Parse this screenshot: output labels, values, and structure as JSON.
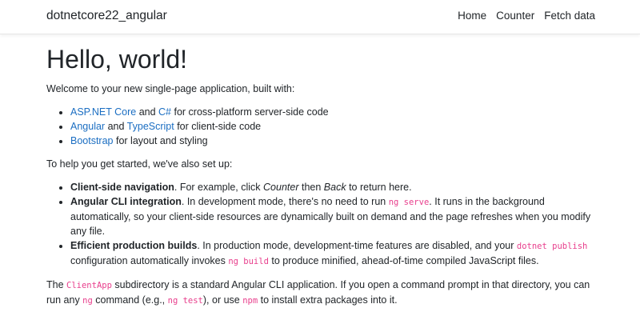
{
  "navbar": {
    "brand": "dotnetcore22_angular",
    "links": [
      "Home",
      "Counter",
      "Fetch data"
    ]
  },
  "main": {
    "title": "Hello, world!",
    "intro": "Welcome to your new single-page application, built with:",
    "tech_list": [
      {
        "link1": "ASP.NET Core",
        "mid": " and ",
        "link2": "C#",
        "tail": " for cross-platform server-side code"
      },
      {
        "link1": "Angular",
        "mid": " and ",
        "link2": "TypeScript",
        "tail": " for client-side code"
      },
      {
        "link1": "Bootstrap",
        "tail": " for layout and styling"
      }
    ],
    "setup_intro": "To help you get started, we've also set up:",
    "features": [
      {
        "title": "Client-side navigation",
        "t1": ". For example, click ",
        "em1": "Counter",
        "t2": " then ",
        "em2": "Back",
        "t3": " to return here."
      },
      {
        "title": "Angular CLI integration",
        "t1": ". In development mode, there's no need to run ",
        "code1": "ng serve",
        "t2": ". It runs in the background automatically, so your client-side resources are dynamically built on demand and the page refreshes when you modify any file."
      },
      {
        "title": "Efficient production builds",
        "t1": ". In production mode, development-time features are disabled, and your ",
        "code1": "dotnet publish",
        "t2": " configuration automatically invokes ",
        "code2": "ng build",
        "t3": " to produce minified, ahead-of-time compiled JavaScript files."
      }
    ],
    "closing": {
      "t1": "The ",
      "code1": "ClientApp",
      "t2": " subdirectory is a standard Angular CLI application. If you open a command prompt in that directory, you can run any ",
      "code2": "ng",
      "t3": " command (e.g., ",
      "code3": "ng test",
      "t4": "), or use ",
      "code4": "npm",
      "t5": " to install extra packages into it."
    }
  },
  "colors": {
    "link": "#1b6ec2",
    "code": "#e83e8c",
    "text": "#212529"
  }
}
